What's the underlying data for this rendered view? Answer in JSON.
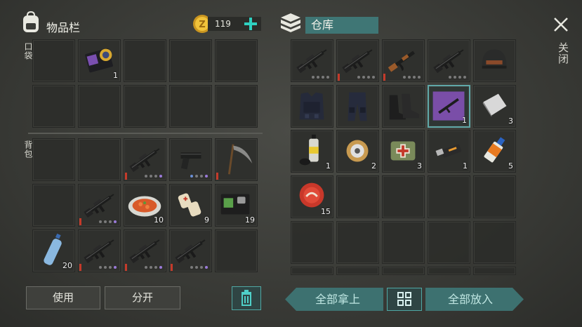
{
  "inventory": {
    "title": "物品栏",
    "coins": "119",
    "pocket_label": "口袋",
    "backpack_label": "背包"
  },
  "storage": {
    "title": "仓库",
    "close_label": "关闭"
  },
  "items": {
    "pocket_badge_qty": "1",
    "bp_food_qty": "10",
    "bp_bandage_qty": "9",
    "bp_wallet_qty": "19",
    "bp_bottle_qty": "20",
    "st_metal_qty": "3",
    "st_spray_qty": "1",
    "st_wire_qty": "2",
    "st_medkit_qty": "3",
    "st_usb_qty": "1",
    "st_glue_qty": "5",
    "st_cap_qty": "15",
    "st_blueprint_qty": "1"
  },
  "buttons": {
    "use": "使用",
    "split": "分开",
    "take_all": "全部拿上",
    "put_all": "全部放入"
  },
  "colors": {
    "accent": "#3d7170",
    "coin": "#e8b830",
    "plus": "#2fd0c0"
  }
}
